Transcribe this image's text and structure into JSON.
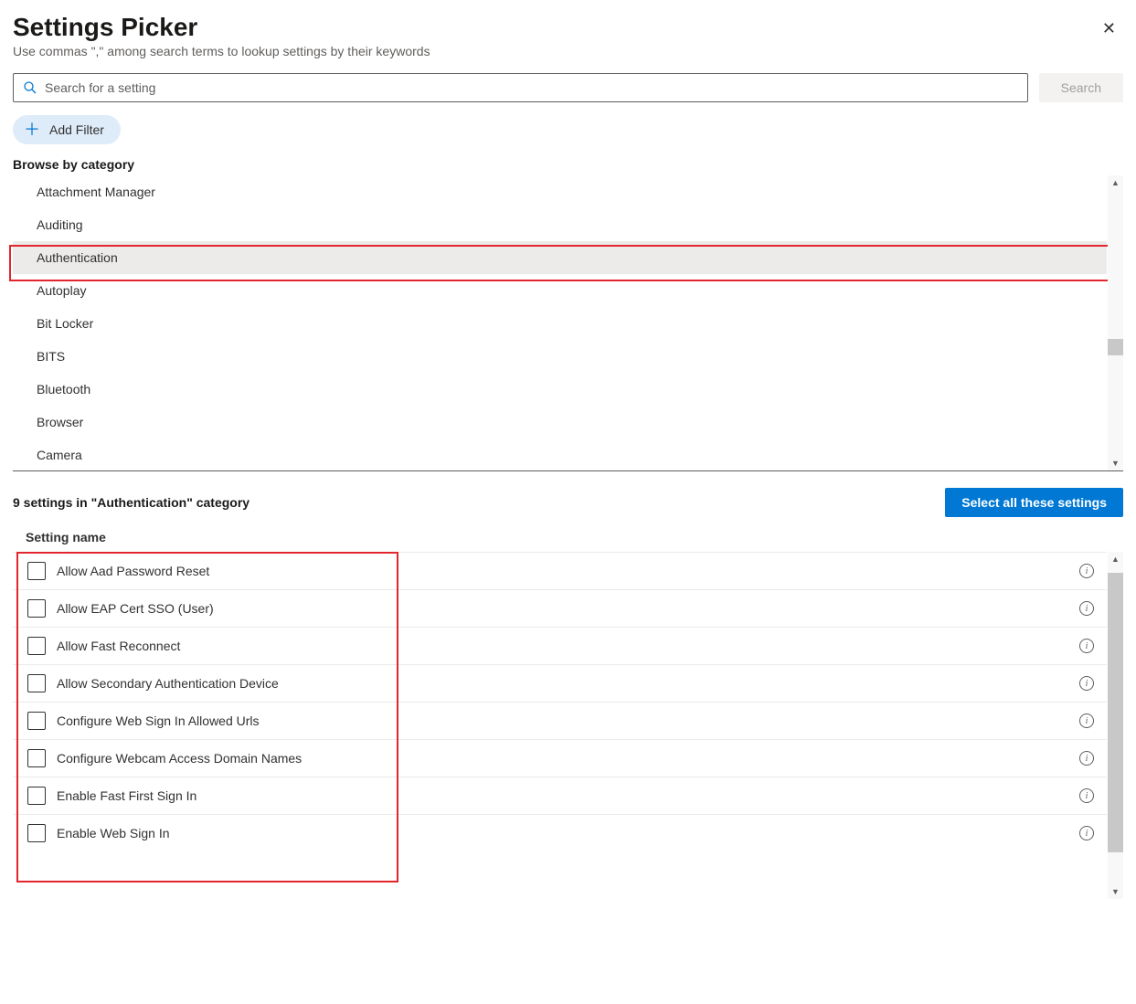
{
  "header": {
    "title": "Settings Picker",
    "subtitle": "Use commas \",\" among search terms to lookup settings by their keywords"
  },
  "search": {
    "placeholder": "Search for a setting",
    "button": "Search"
  },
  "filter": {
    "add": "Add Filter"
  },
  "browse": {
    "heading": "Browse by category",
    "categories": [
      "Attachment Manager",
      "Auditing",
      "Authentication",
      "Autoplay",
      "Bit Locker",
      "BITS",
      "Bluetooth",
      "Browser",
      "Camera"
    ],
    "selected_index": 2
  },
  "results": {
    "count_text": "9 settings in \"Authentication\" category",
    "select_all": "Select all these settings",
    "column_header": "Setting name",
    "settings": [
      "Allow Aad Password Reset",
      "Allow EAP Cert SSO (User)",
      "Allow Fast Reconnect",
      "Allow Secondary Authentication Device",
      "Configure Web Sign In Allowed Urls",
      "Configure Webcam Access Domain Names",
      "Enable Fast First Sign In",
      "Enable Web Sign In"
    ]
  }
}
